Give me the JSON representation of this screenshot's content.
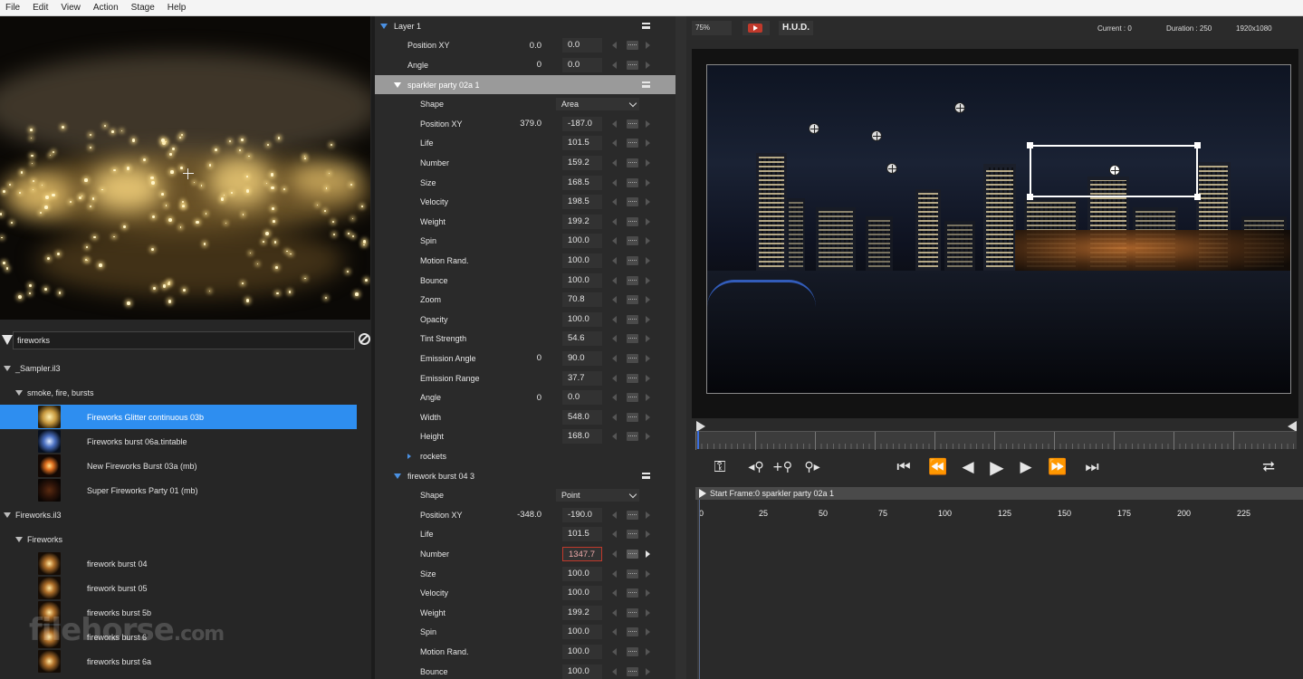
{
  "menu": [
    "File",
    "Edit",
    "View",
    "Action",
    "Stage",
    "Help"
  ],
  "search": {
    "value": "fireworks"
  },
  "tree": [
    {
      "label": "_Sampler.il3",
      "level": 0,
      "type": "group"
    },
    {
      "label": "smoke, fire, bursts",
      "level": 1,
      "type": "group"
    },
    {
      "label": "Fireworks Glitter continuous 03b",
      "level": 2,
      "type": "item",
      "selected": true,
      "thumb": "glitter"
    },
    {
      "label": "Fireworks burst 06a.tintable",
      "level": 2,
      "type": "item",
      "thumb": "blue"
    },
    {
      "label": "New Fireworks Burst 03a (mb)",
      "level": 2,
      "type": "item",
      "thumb": "orange"
    },
    {
      "label": "Super Fireworks Party 01 (mb)",
      "level": 2,
      "type": "item",
      "thumb": "dark"
    },
    {
      "label": "Fireworks.il3",
      "level": 0,
      "type": "group"
    },
    {
      "label": "Fireworks",
      "level": 1,
      "type": "group"
    },
    {
      "label": "firework burst 04",
      "level": 2,
      "type": "item",
      "thumb": "burst"
    },
    {
      "label": "firework burst 05",
      "level": 2,
      "type": "item",
      "thumb": "burst"
    },
    {
      "label": "fireworks burst 5b",
      "level": 2,
      "type": "item",
      "thumb": "burst"
    },
    {
      "label": "fireworks burst 6",
      "level": 2,
      "type": "item",
      "thumb": "burst"
    },
    {
      "label": "fireworks burst 6a",
      "level": 2,
      "type": "item",
      "thumb": "burst"
    }
  ],
  "watermark": {
    "main": "filehorse",
    "suffix": ".com"
  },
  "params": [
    {
      "kind": "section",
      "label": "Layer 1",
      "indent": 0
    },
    {
      "kind": "param",
      "label": "Position XY",
      "indent": 1,
      "v1": "0.0",
      "v2": "0.0"
    },
    {
      "kind": "param",
      "label": "Angle",
      "indent": 1,
      "v1": "0",
      "v2": "0.0"
    },
    {
      "kind": "section",
      "label": "sparkler party 02a 1",
      "indent": 1,
      "selected": true
    },
    {
      "kind": "select",
      "label": "Shape",
      "indent": 2,
      "value": "Area"
    },
    {
      "kind": "param",
      "label": "Position XY",
      "indent": 2,
      "v1": "379.0",
      "v2": "-187.0"
    },
    {
      "kind": "param",
      "label": "Life",
      "indent": 2,
      "v1": "",
      "v2": "101.5"
    },
    {
      "kind": "param",
      "label": "Number",
      "indent": 2,
      "v1": "",
      "v2": "159.2"
    },
    {
      "kind": "param",
      "label": "Size",
      "indent": 2,
      "v1": "",
      "v2": "168.5"
    },
    {
      "kind": "param",
      "label": "Velocity",
      "indent": 2,
      "v1": "",
      "v2": "198.5"
    },
    {
      "kind": "param",
      "label": "Weight",
      "indent": 2,
      "v1": "",
      "v2": "199.2"
    },
    {
      "kind": "param",
      "label": "Spin",
      "indent": 2,
      "v1": "",
      "v2": "100.0"
    },
    {
      "kind": "param",
      "label": "Motion Rand.",
      "indent": 2,
      "v1": "",
      "v2": "100.0"
    },
    {
      "kind": "param",
      "label": "Bounce",
      "indent": 2,
      "v1": "",
      "v2": "100.0"
    },
    {
      "kind": "param",
      "label": "Zoom",
      "indent": 2,
      "v1": "",
      "v2": "70.8"
    },
    {
      "kind": "param",
      "label": "Opacity",
      "indent": 2,
      "v1": "",
      "v2": "100.0"
    },
    {
      "kind": "param",
      "label": "Tint Strength",
      "indent": 2,
      "v1": "",
      "v2": "54.6"
    },
    {
      "kind": "param",
      "label": "Emission Angle",
      "indent": 2,
      "v1": "0",
      "v2": "90.0"
    },
    {
      "kind": "param",
      "label": "Emission Range",
      "indent": 2,
      "v1": "",
      "v2": "37.7"
    },
    {
      "kind": "param",
      "label": "Angle",
      "indent": 2,
      "v1": "0",
      "v2": "0.0"
    },
    {
      "kind": "param",
      "label": "Width",
      "indent": 2,
      "v1": "",
      "v2": "548.0"
    },
    {
      "kind": "param",
      "label": "Height",
      "indent": 2,
      "v1": "",
      "v2": "168.0"
    },
    {
      "kind": "subsection",
      "label": "rockets",
      "indent": 2
    },
    {
      "kind": "section",
      "label": "firework burst 04 3",
      "indent": 1
    },
    {
      "kind": "select",
      "label": "Shape",
      "indent": 2,
      "value": "Point"
    },
    {
      "kind": "param",
      "label": "Position XY",
      "indent": 2,
      "v1": "-348.0",
      "v2": "-190.0"
    },
    {
      "kind": "param",
      "label": "Life",
      "indent": 2,
      "v1": "",
      "v2": "101.5"
    },
    {
      "kind": "param",
      "label": "Number",
      "indent": 2,
      "v1": "",
      "v2": "1347.7",
      "editing": true
    },
    {
      "kind": "param",
      "label": "Size",
      "indent": 2,
      "v1": "",
      "v2": "100.0"
    },
    {
      "kind": "param",
      "label": "Velocity",
      "indent": 2,
      "v1": "",
      "v2": "100.0"
    },
    {
      "kind": "param",
      "label": "Weight",
      "indent": 2,
      "v1": "",
      "v2": "199.2"
    },
    {
      "kind": "param",
      "label": "Spin",
      "indent": 2,
      "v1": "",
      "v2": "100.0"
    },
    {
      "kind": "param",
      "label": "Motion Rand.",
      "indent": 2,
      "v1": "",
      "v2": "100.0"
    },
    {
      "kind": "param",
      "label": "Bounce",
      "indent": 2,
      "v1": "",
      "v2": "100.0"
    }
  ],
  "viewer": {
    "zoom": "75%",
    "hud_label": "H.U.D.",
    "current": "Current : 0",
    "duration": "Duration : 250",
    "resolution": "1920x1080"
  },
  "transport": {
    "key_icon": "key-icon",
    "play_icon": "play-icon"
  },
  "lane": {
    "header": "Start Frame:0 sparkler party 02a 1",
    "ticks": [
      "0",
      "25",
      "50",
      "75",
      "100",
      "125",
      "150",
      "175",
      "200",
      "225"
    ]
  },
  "colors": {
    "selection": "#2e8ef0",
    "accent": "#4a90e2",
    "playhead": "#3b6fe0"
  }
}
